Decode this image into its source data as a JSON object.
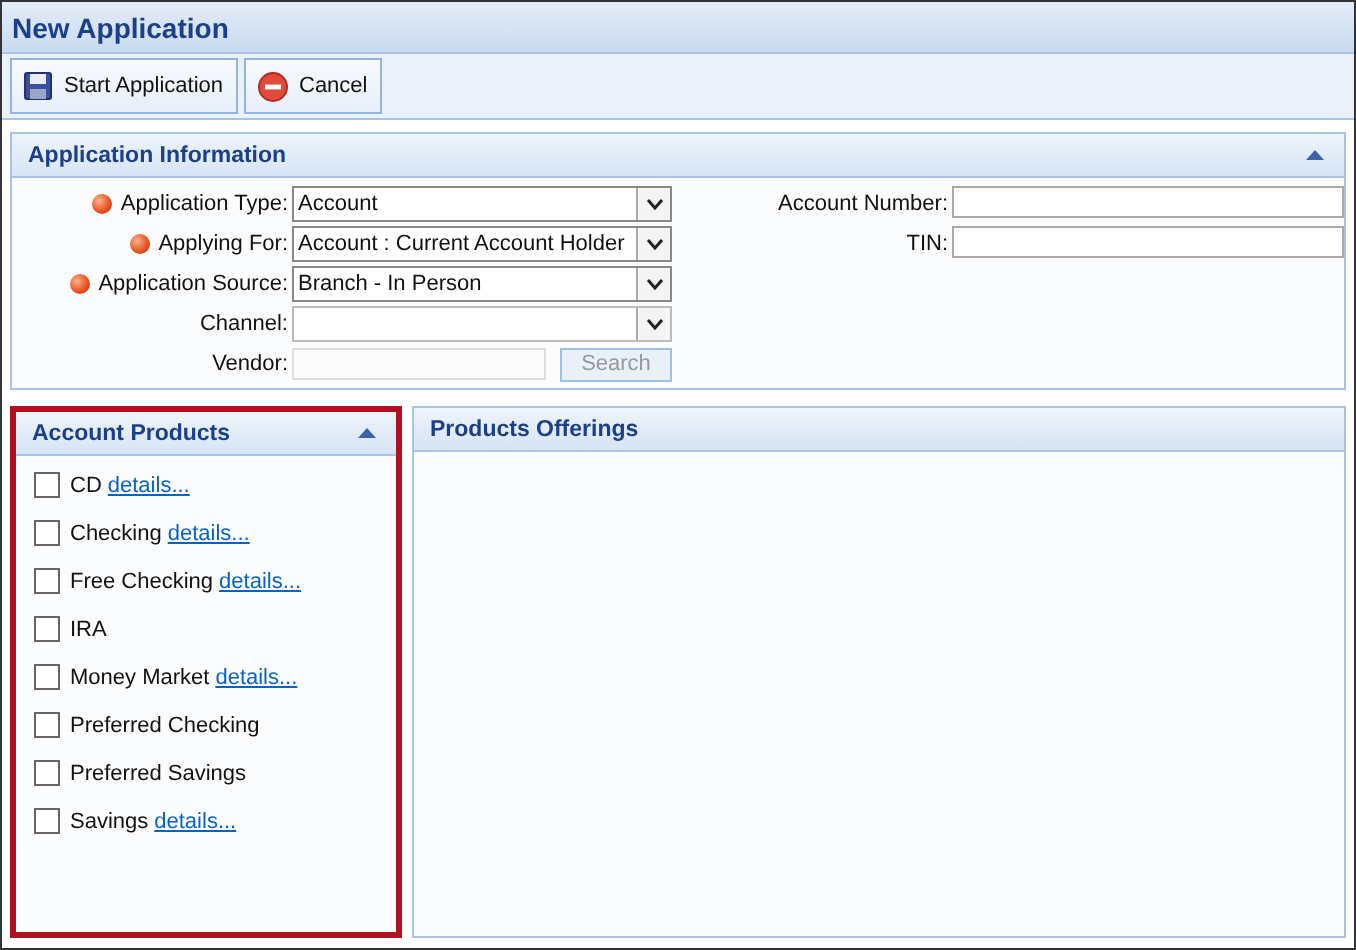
{
  "window": {
    "title": "New Application"
  },
  "toolbar": [
    {
      "kind": "save",
      "label": "Start Application"
    },
    {
      "kind": "cancel",
      "label": "Cancel"
    }
  ],
  "application_information": {
    "title": "Application Information",
    "left_fields": [
      {
        "label": "Application Type:",
        "kind": "select",
        "value": "Account",
        "required": true,
        "disabled": false
      },
      {
        "label": "Applying For:",
        "kind": "select",
        "value": "Account : Current Account Holder",
        "required": true,
        "disabled": false
      },
      {
        "label": "Application Source:",
        "kind": "select",
        "value": "Branch - In Person",
        "required": true,
        "disabled": false
      },
      {
        "label": "Channel:",
        "kind": "select",
        "required": false,
        "disabled": true
      },
      {
        "label": "Vendor:",
        "kind": "text",
        "required": false,
        "disabled": true,
        "button": "Search"
      }
    ],
    "right_fields": [
      {
        "label": "Account Number:"
      },
      {
        "label": "TIN:"
      }
    ]
  },
  "account_products": {
    "title": "Account Products",
    "highlighted": true,
    "items": [
      {
        "name": "CD",
        "checked": false,
        "link": "details..."
      },
      {
        "name": "Checking",
        "checked": false,
        "link": "details..."
      },
      {
        "name": "Free Checking",
        "checked": false,
        "link": "details..."
      },
      {
        "name": "IRA",
        "checked": false
      },
      {
        "name": "Money Market",
        "checked": false,
        "link": "details..."
      },
      {
        "name": "Preferred Checking",
        "checked": false
      },
      {
        "name": "Preferred Savings",
        "checked": false
      },
      {
        "name": "Savings",
        "checked": false,
        "link": "details..."
      }
    ]
  },
  "products_offerings": {
    "title": "Products Offerings"
  }
}
